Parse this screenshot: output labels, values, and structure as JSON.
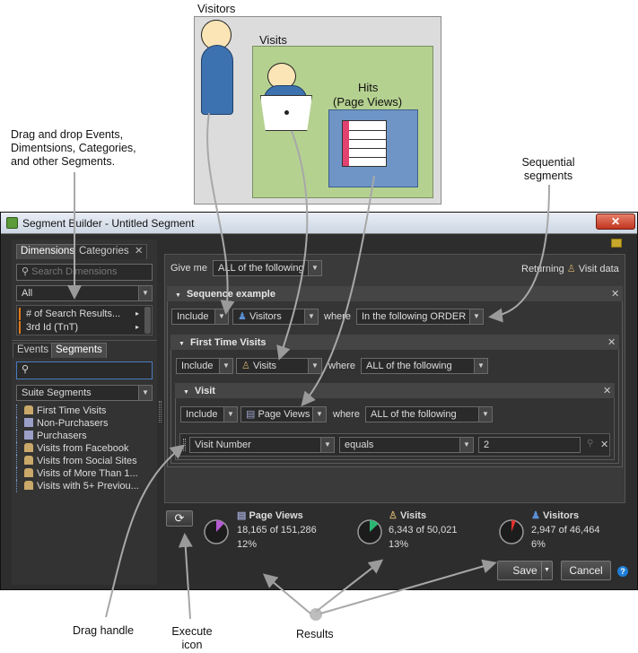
{
  "diagram": {
    "visitors_label": "Visitors",
    "visits_label": "Visits",
    "hits_label_line1": "Hits",
    "hits_label_line2": "(Page Views)"
  },
  "callouts": {
    "drag_drop": [
      "Drag and drop Events,",
      "Dimentsions, Categories,",
      "and other Segments."
    ],
    "sequential": [
      "Sequential",
      "segments"
    ],
    "drag_handle": "Drag handle",
    "execute_icon": [
      "Execute",
      "icon"
    ],
    "results": "Results"
  },
  "window": {
    "title": "Segment Builder - Untitled Segment",
    "left_tabs_top": [
      "Dimensions",
      "Categories"
    ],
    "search_dimensions_placeholder": "Search Dimensions",
    "dim_filter": "All",
    "dim_items": [
      "# of Search Results...",
      "3rd Id (TnT)"
    ],
    "left_tabs_bottom": [
      "Events",
      "Segments"
    ],
    "segments_filter": "Suite Segments",
    "segment_items": [
      {
        "label": "First Time Visits",
        "icon": "visit-icon"
      },
      {
        "label": "Non-Purchasers",
        "icon": "page-icon"
      },
      {
        "label": "Purchasers",
        "icon": "page-icon"
      },
      {
        "label": "Visits from Facebook",
        "icon": "visit-icon"
      },
      {
        "label": "Visits from Social Sites",
        "icon": "visit-icon"
      },
      {
        "label": "Visits of More Than 1...",
        "icon": "visit-icon"
      },
      {
        "label": "Visits with 5+ Previou...",
        "icon": "visit-icon"
      }
    ],
    "give_me_label": "Give me",
    "give_me_value": "ALL of the following",
    "returning_label": "Returning",
    "returning_value": "Visit data",
    "sequence": {
      "title": "Sequence example",
      "include": "Include",
      "target": "Visitors",
      "where": "where",
      "condition": "In the following ORDER"
    },
    "first_time": {
      "title": "First Time Visits",
      "include": "Include",
      "target": "Visits",
      "where": "where",
      "condition": "ALL of the following"
    },
    "visit": {
      "title": "Visit",
      "include": "Include",
      "target": "Page Views",
      "where": "where",
      "condition": "ALL of the following"
    },
    "rule": {
      "dimension": "Visit Number",
      "operator": "equals",
      "value": "2"
    },
    "results": [
      {
        "title": "Page Views",
        "count": "18,165 of 151,286",
        "pct": "12%",
        "fraction": 0.12,
        "color": "#b45bd0",
        "icon": "page-icon"
      },
      {
        "title": "Visits",
        "count": "6,343 of 50,021",
        "pct": "13%",
        "fraction": 0.13,
        "color": "#2bb673",
        "icon": "visit-icon"
      },
      {
        "title": "Visitors",
        "count": "2,947 of 46,464",
        "pct": "6%",
        "fraction": 0.06,
        "color": "#e0312b",
        "icon": "visitor-icon"
      }
    ],
    "save_label": "Save",
    "cancel_label": "Cancel"
  }
}
